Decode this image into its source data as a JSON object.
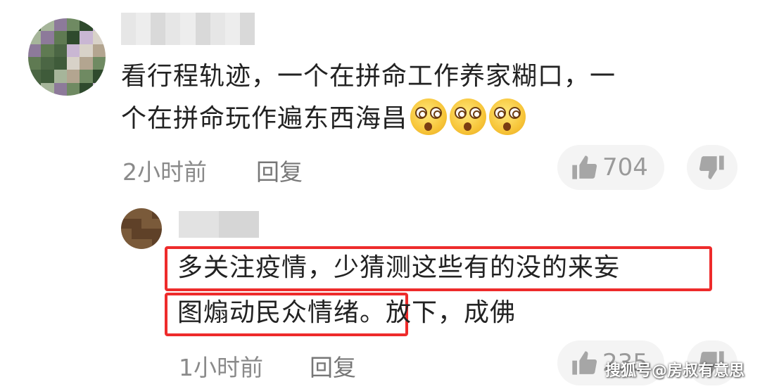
{
  "comments": [
    {
      "text_line1": "看行程轨迹，一个在拼命工作养家糊口，一",
      "text_line2": "个在拼命玩作遍东西海昌",
      "emojis": [
        "dizzy-face-emoji",
        "dizzy-face-emoji",
        "dizzy-face-emoji"
      ],
      "time": "2小时前",
      "reply_label": "回复",
      "likes": "704"
    },
    {
      "text_line1": "多关注疫情，少猜测这些有的没的来妄",
      "text_line2_highlight": "图煽动民众情绪",
      "text_line2_rest": "。放下，成佛",
      "time": "1小时前",
      "reply_label": "回复",
      "likes": "235"
    }
  ],
  "watermark": "搜狐号@房叔有意思",
  "colors": {
    "highlight_border": "#ee2b2b",
    "meta_text": "#8a8a8a",
    "body_text": "#222222"
  }
}
